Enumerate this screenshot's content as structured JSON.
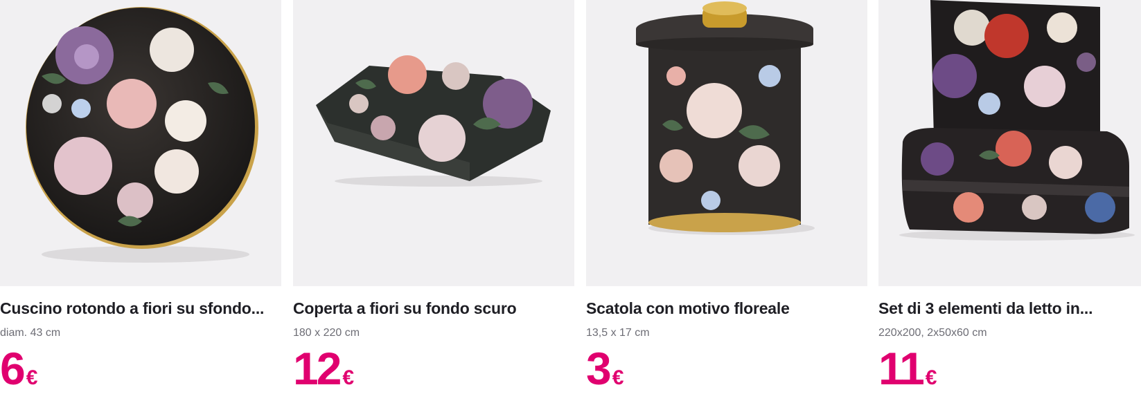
{
  "products": [
    {
      "title": "Cuscino rotondo a fiori su sfondo...",
      "size": "diam. 43 cm",
      "price": "6",
      "currency": "€",
      "image_icon": "round-floral-cushion-icon"
    },
    {
      "title": "Coperta a fiori su fondo scuro",
      "size": "180 x 220 cm",
      "price": "12",
      "currency": "€",
      "image_icon": "folded-floral-blanket-icon"
    },
    {
      "title": "Scatola con motivo floreale",
      "size": "13,5 x 17 cm",
      "price": "3",
      "currency": "€",
      "image_icon": "floral-tin-box-icon"
    },
    {
      "title": "Set di 3 elementi da letto in...",
      "size": "220x200, 2x50x60 cm",
      "price": "11",
      "currency": "€",
      "image_icon": "floral-bedding-set-icon"
    }
  ],
  "colors": {
    "price": "#e0006f",
    "image_bg": "#f1f0f2",
    "title": "#1e1e24",
    "meta": "#6d6d75"
  }
}
